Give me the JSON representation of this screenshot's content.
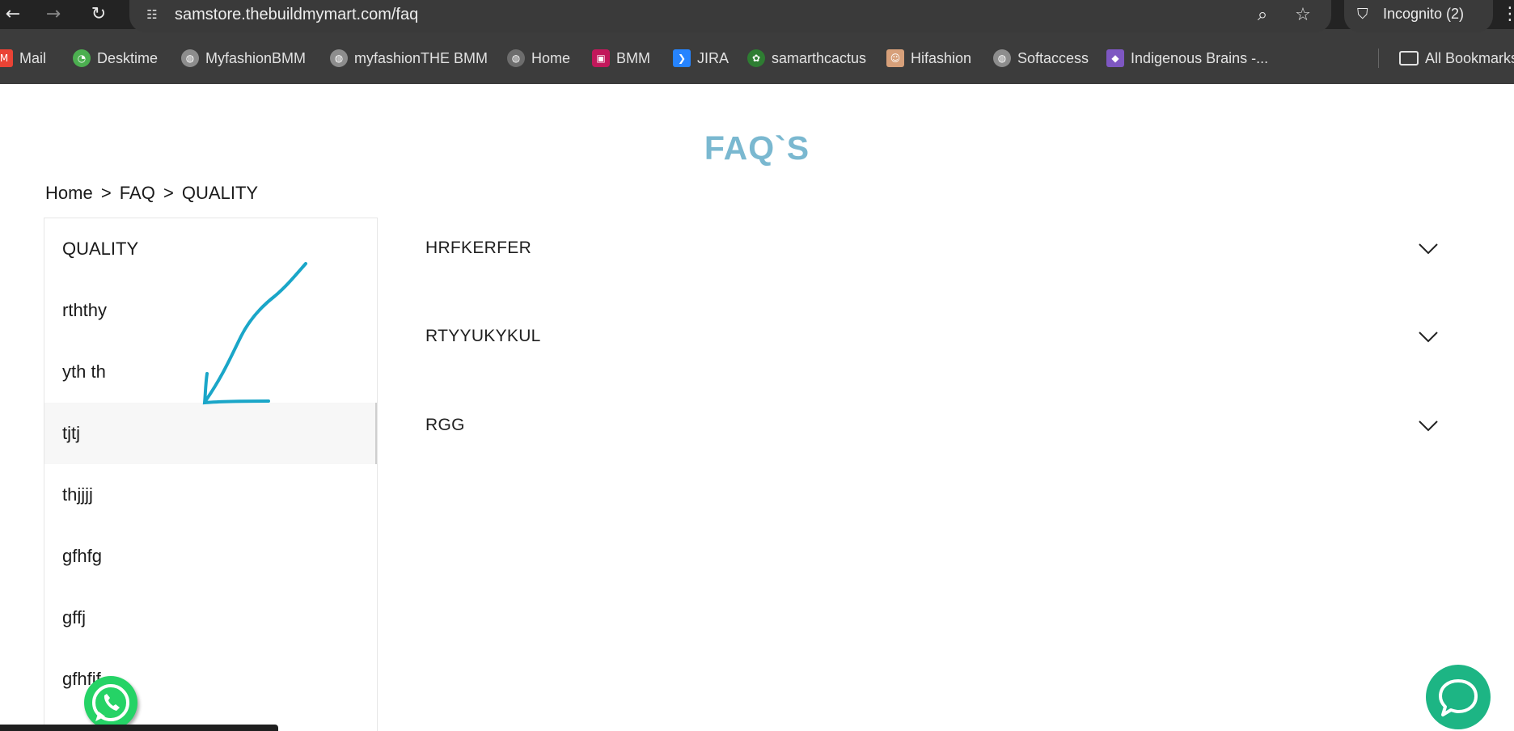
{
  "browser": {
    "url": "samstore.thebuildmymart.com/faq",
    "incognito_label": "Incognito (2)",
    "all_bookmarks_label": "All Bookmarks"
  },
  "bookmarks": [
    {
      "label": "Mail",
      "icon": "gmail-icon",
      "color": "#ea4335"
    },
    {
      "label": "Desktime",
      "icon": "desktime-icon",
      "color": "#4caf50"
    },
    {
      "label": "MyfashionBMM",
      "icon": "globe-icon",
      "color": "#9e9e9e"
    },
    {
      "label": "myfashionTHE BMM",
      "icon": "globe-icon",
      "color": "#9e9e9e"
    },
    {
      "label": "Home",
      "icon": "globe-icon",
      "color": "#757575"
    },
    {
      "label": "BMM",
      "icon": "bmm-icon",
      "color": "#c2185b"
    },
    {
      "label": "JIRA",
      "icon": "jira-icon",
      "color": "#2684ff"
    },
    {
      "label": "samarthcactus",
      "icon": "cactus-icon",
      "color": "#2e7d32"
    },
    {
      "label": "Hifashion",
      "icon": "avatar-icon",
      "color": "#d7a07a"
    },
    {
      "label": "Softaccess",
      "icon": "globe-icon",
      "color": "#9e9e9e"
    },
    {
      "label": "Indigenous Brains -...",
      "icon": "brain-icon",
      "color": "#7e57c2"
    }
  ],
  "page": {
    "title": "FAQ`S",
    "title_color": "#7ab8d0",
    "breadcrumb": [
      "Home",
      "FAQ",
      "QUALITY"
    ],
    "breadcrumb_separator": ">"
  },
  "sidebar": {
    "items": [
      {
        "label": "QUALITY",
        "active": false
      },
      {
        "label": "rththy",
        "active": false
      },
      {
        "label": "yth th",
        "active": false
      },
      {
        "label": "tjtj",
        "active": true
      },
      {
        "label": "thjjjj",
        "active": false
      },
      {
        "label": "gfhfg",
        "active": false
      },
      {
        "label": "gffj",
        "active": false
      },
      {
        "label": "gfhfjf",
        "active": false
      }
    ]
  },
  "faqs": [
    {
      "question": "HRFKERFER"
    },
    {
      "question": "RTYYUKYKUL"
    },
    {
      "question": "RGG"
    }
  ],
  "colors": {
    "annotation_arrow": "#1aa6c8",
    "whatsapp": "#25d366",
    "chat": "#1db584"
  }
}
